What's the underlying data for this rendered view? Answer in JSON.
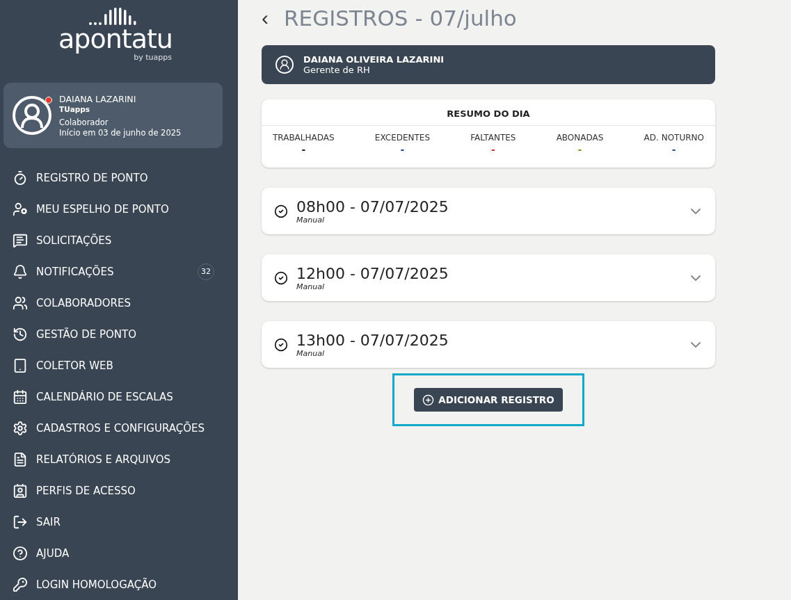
{
  "logo": {
    "name": "apontatu",
    "byline": "by tuapps"
  },
  "profile": {
    "name": "DAIANA LAZARINI",
    "company": "TUapps",
    "role": "Colaborador",
    "since": "Início em 03 de junho de 2025",
    "alert": true
  },
  "menu": [
    {
      "label": "REGISTRO DE PONTO"
    },
    {
      "label": "MEU ESPELHO DE PONTO"
    },
    {
      "label": "SOLICITAÇÕES"
    },
    {
      "label": "NOTIFICAÇÕES",
      "count": "32"
    },
    {
      "label": "COLABORADORES"
    },
    {
      "label": "GESTÃO DE PONTO"
    },
    {
      "label": "COLETOR WEB"
    },
    {
      "label": "CALENDÁRIO DE ESCALAS"
    },
    {
      "label": "CADASTROS E CONFIGURAÇÕES"
    },
    {
      "label": "RELATÓRIOS E ARQUIVOS"
    },
    {
      "label": "PERFIS DE ACESSO"
    },
    {
      "label": "SAIR"
    },
    {
      "label": "AJUDA"
    },
    {
      "label": "LOGIN HOMOLOGAÇÃO"
    }
  ],
  "page": {
    "back": "‹",
    "title": "REGISTROS - 07/julho"
  },
  "employee": {
    "name": "DAIANA OLIVEIRA LAZARINI",
    "position": "Gerente de RH"
  },
  "summary": {
    "title": "RESUMO DO DIA",
    "items": [
      {
        "label": "TRABALHADAS",
        "value": "-",
        "color": "#222222"
      },
      {
        "label": "EXCEDENTES",
        "value": "-",
        "color": "#2b4aa0"
      },
      {
        "label": "FALTANTES",
        "value": "-",
        "color": "#e02b20"
      },
      {
        "label": "ABONADAS",
        "value": "-",
        "color": "#7a9a10"
      },
      {
        "label": "AD. NOTURNO",
        "value": "-",
        "color": "#2b4aa0"
      }
    ]
  },
  "records": [
    {
      "time": "08h00 - 07/07/2025",
      "source": "Manual",
      "expanded": false
    },
    {
      "time": "12h00 - 07/07/2025",
      "source": "Manual",
      "expanded": false
    },
    {
      "time": "13h00 - 07/07/2025",
      "source": "Manual",
      "expanded": false
    }
  ],
  "add_button": {
    "label": "ADICIONAR REGISTRO",
    "highlighted": true
  }
}
